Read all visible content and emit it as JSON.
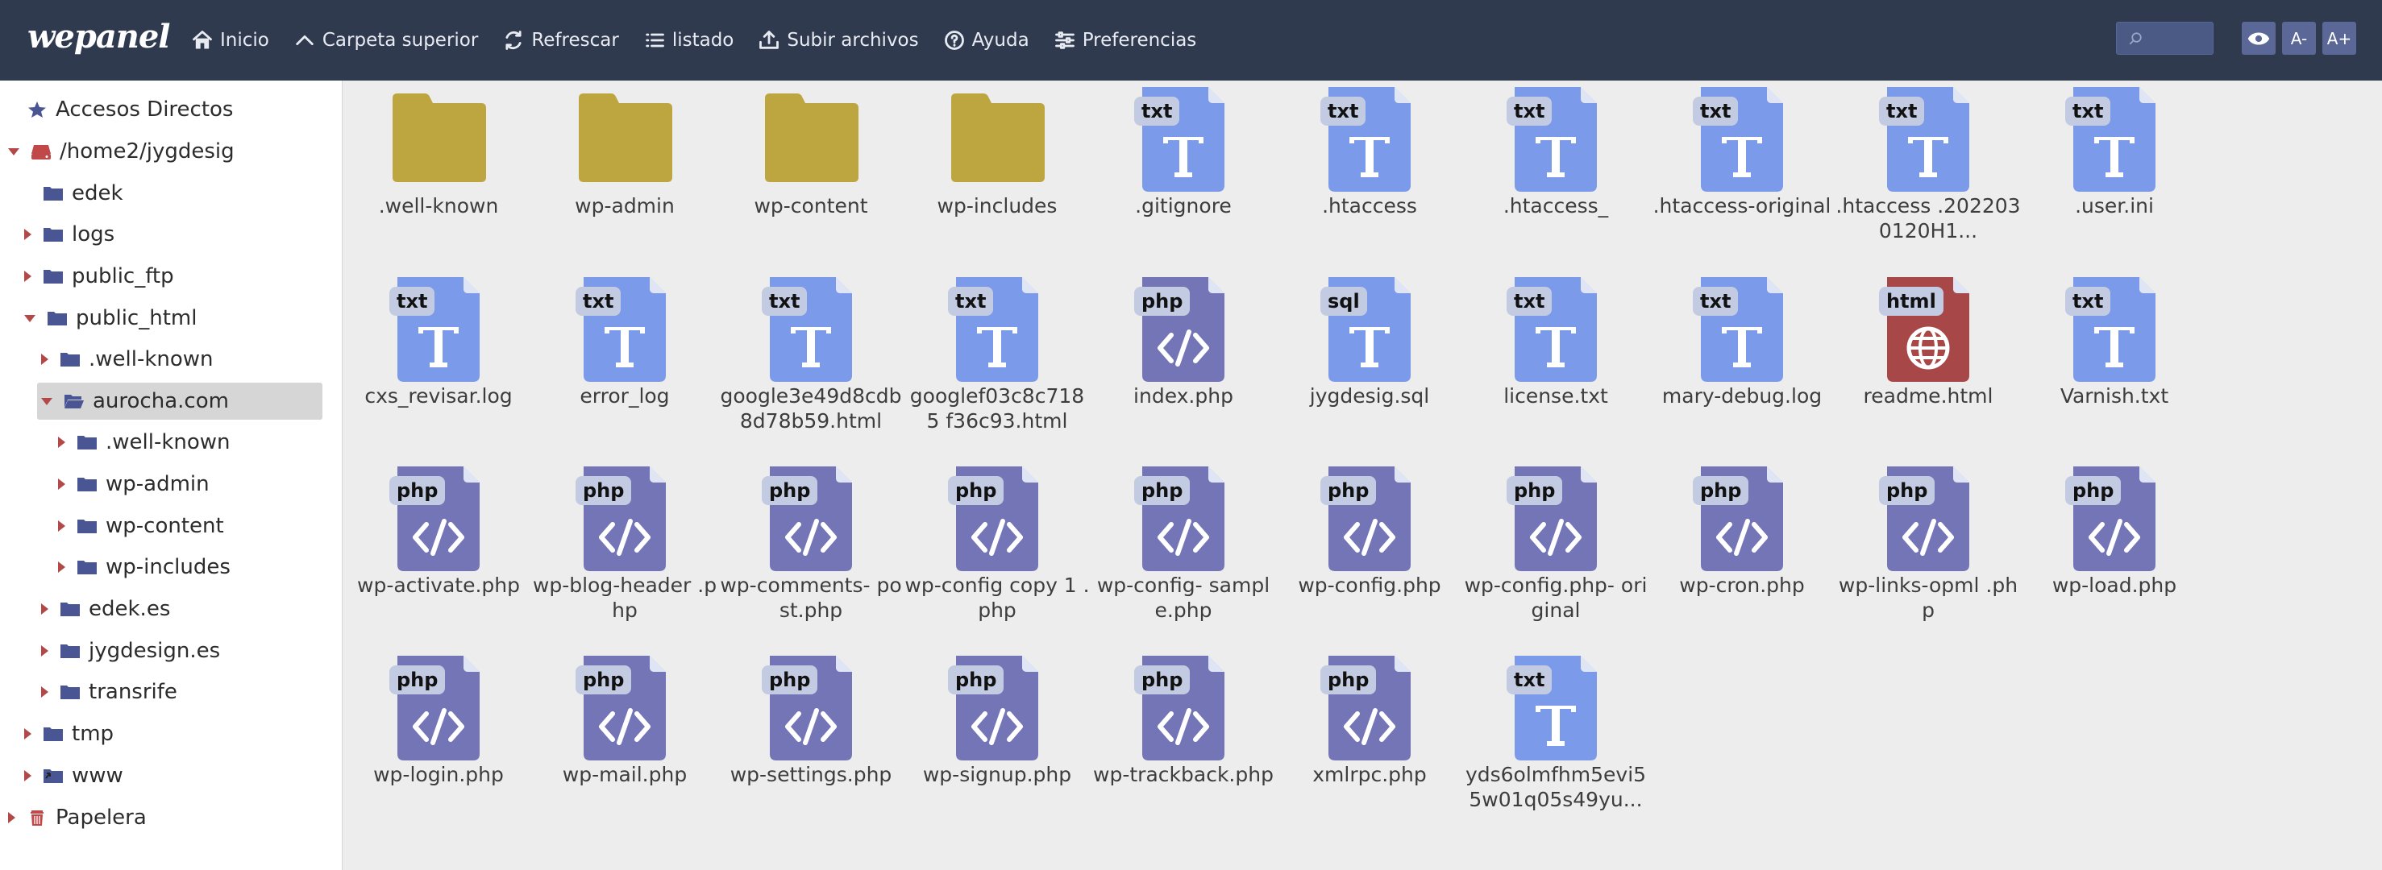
{
  "app": {
    "logo": "wepanel"
  },
  "toolbar": {
    "items": [
      {
        "label": "Inicio",
        "icon": "home-icon"
      },
      {
        "label": "Carpeta superior",
        "icon": "chevron-up-icon"
      },
      {
        "label": "Refrescar",
        "icon": "refresh-icon"
      },
      {
        "label": "listado",
        "icon": "list-icon"
      },
      {
        "label": "Subir archivos",
        "icon": "upload-icon"
      },
      {
        "label": "Ayuda",
        "icon": "help-icon"
      },
      {
        "label": "Preferencias",
        "icon": "sliders-icon"
      }
    ],
    "search_value": "",
    "buttons": [
      {
        "label": "",
        "icon": "eye-icon"
      },
      {
        "label": "A-",
        "icon": ""
      },
      {
        "label": "A+",
        "icon": ""
      }
    ]
  },
  "colors": {
    "topbar": "#2f3a4f",
    "folder": "#bda640",
    "txt": "#7b9bea",
    "php": "#7375b6",
    "html": "#a84747",
    "caret": "#b34848"
  },
  "sidebar": {
    "items": [
      {
        "label": "Accesos Directos",
        "icon": "star-icon",
        "caret": "none",
        "depth": 0
      },
      {
        "label": "/home2/jygdesig",
        "icon": "drive-icon",
        "caret": "down",
        "depth": 0
      },
      {
        "label": "edek",
        "icon": "folder-icon",
        "caret": "none",
        "depth": 1
      },
      {
        "label": "logs",
        "icon": "folder-icon",
        "caret": "right",
        "depth": 1
      },
      {
        "label": "public_ftp",
        "icon": "folder-icon",
        "caret": "right",
        "depth": 1
      },
      {
        "label": "public_html",
        "icon": "folder-icon",
        "caret": "down",
        "depth": 1
      },
      {
        "label": ".well-known",
        "icon": "folder-icon",
        "caret": "right",
        "depth": 2
      },
      {
        "label": "aurocha.com",
        "icon": "folder-open-icon",
        "caret": "down",
        "depth": 2,
        "selected": true
      },
      {
        "label": ".well-known",
        "icon": "folder-icon",
        "caret": "right",
        "depth": 3
      },
      {
        "label": "wp-admin",
        "icon": "folder-icon",
        "caret": "right",
        "depth": 3
      },
      {
        "label": "wp-content",
        "icon": "folder-icon",
        "caret": "right",
        "depth": 3
      },
      {
        "label": "wp-includes",
        "icon": "folder-icon",
        "caret": "right",
        "depth": 3
      },
      {
        "label": "edek.es",
        "icon": "folder-icon",
        "caret": "right",
        "depth": 2
      },
      {
        "label": "jygdesign.es",
        "icon": "folder-icon",
        "caret": "right",
        "depth": 2
      },
      {
        "label": "transrife",
        "icon": "folder-icon",
        "caret": "right",
        "depth": 2
      },
      {
        "label": "tmp",
        "icon": "folder-icon",
        "caret": "right",
        "depth": 1
      },
      {
        "label": "www",
        "icon": "folder-link-icon",
        "caret": "right",
        "depth": 1
      },
      {
        "label": "Papelera",
        "icon": "trash-icon",
        "caret": "right",
        "depth": 0
      }
    ]
  },
  "files": [
    {
      "name": ".well-known",
      "type": "folder",
      "badge": ""
    },
    {
      "name": "wp-admin",
      "type": "folder",
      "badge": ""
    },
    {
      "name": "wp-content",
      "type": "folder",
      "badge": ""
    },
    {
      "name": "wp-includes",
      "type": "folder",
      "badge": ""
    },
    {
      "name": ".gitignore",
      "type": "txt",
      "badge": "txt"
    },
    {
      "name": ".htaccess",
      "type": "txt",
      "badge": "txt"
    },
    {
      "name": ".htaccess_",
      "type": "txt",
      "badge": "txt"
    },
    {
      "name": ".htaccess-original",
      "type": "txt",
      "badge": "txt"
    },
    {
      "name": ".htaccess .2022030120H1...",
      "type": "txt",
      "badge": "txt"
    },
    {
      "name": ".user.ini",
      "type": "txt",
      "badge": "txt"
    },
    {
      "name": "cxs_revisar.log",
      "type": "txt",
      "badge": "txt"
    },
    {
      "name": "error_log",
      "type": "txt",
      "badge": "txt"
    },
    {
      "name": "google3e49d8cdb 8d78b59.html",
      "type": "txt",
      "badge": "txt"
    },
    {
      "name": "googlef03c8c7185 f36c93.html",
      "type": "txt",
      "badge": "txt"
    },
    {
      "name": "index.php",
      "type": "php",
      "badge": "php"
    },
    {
      "name": "jygdesig.sql",
      "type": "txt",
      "badge": "sql"
    },
    {
      "name": "license.txt",
      "type": "txt",
      "badge": "txt"
    },
    {
      "name": "mary-debug.log",
      "type": "txt",
      "badge": "txt"
    },
    {
      "name": "readme.html",
      "type": "html",
      "badge": "html"
    },
    {
      "name": "Varnish.txt",
      "type": "txt",
      "badge": "txt"
    },
    {
      "name": "wp-activate.php",
      "type": "php",
      "badge": "php"
    },
    {
      "name": "wp-blog-header .php",
      "type": "php",
      "badge": "php"
    },
    {
      "name": "wp-comments- post.php",
      "type": "php",
      "badge": "php"
    },
    {
      "name": "wp-config copy 1 .php",
      "type": "php",
      "badge": "php"
    },
    {
      "name": "wp-config- sample.php",
      "type": "php",
      "badge": "php"
    },
    {
      "name": "wp-config.php",
      "type": "php",
      "badge": "php"
    },
    {
      "name": "wp-config.php- original",
      "type": "php",
      "badge": "php"
    },
    {
      "name": "wp-cron.php",
      "type": "php",
      "badge": "php"
    },
    {
      "name": "wp-links-opml .php",
      "type": "php",
      "badge": "php"
    },
    {
      "name": "wp-load.php",
      "type": "php",
      "badge": "php"
    },
    {
      "name": "wp-login.php",
      "type": "php",
      "badge": "php"
    },
    {
      "name": "wp-mail.php",
      "type": "php",
      "badge": "php"
    },
    {
      "name": "wp-settings.php",
      "type": "php",
      "badge": "php"
    },
    {
      "name": "wp-signup.php",
      "type": "php",
      "badge": "php"
    },
    {
      "name": "wp-trackback.php",
      "type": "php",
      "badge": "php"
    },
    {
      "name": "xmlrpc.php",
      "type": "php",
      "badge": "php"
    },
    {
      "name": "yds6olmfhm5evi5 5w01q05s49yu...",
      "type": "txt",
      "badge": "txt"
    }
  ]
}
